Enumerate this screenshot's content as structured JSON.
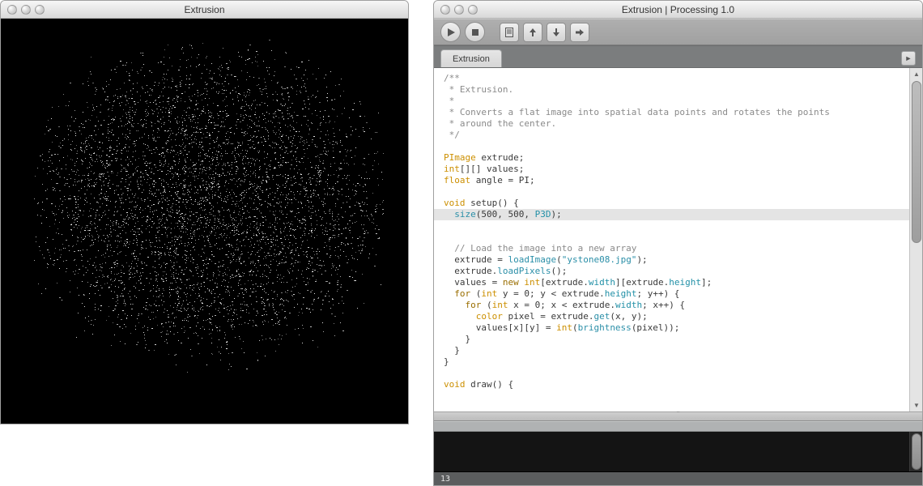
{
  "sketch_window": {
    "title": "Extrusion"
  },
  "ide_window": {
    "title": "Extrusion | Processing 1.0",
    "toolbar": {
      "run": "Run",
      "stop": "Stop",
      "new": "New",
      "open": "Open",
      "save": "Save",
      "export": "Export"
    },
    "tab": {
      "label": "Extrusion",
      "add_tooltip": "New tab"
    }
  },
  "code": {
    "comment_block": [
      "/**",
      " * Extrusion.",
      " *",
      " * Converts a flat image into spatial data points and rotates the points",
      " * around the center.",
      " */"
    ],
    "decl": {
      "PImage": "PImage",
      "extrude_var": "extrude;",
      "int": "int",
      "values_decl": "[][] values;",
      "float": "float",
      "angle_decl": "angle = PI;"
    },
    "setup": {
      "void": "void",
      "setup_sig": "setup() {",
      "size_fn": "size",
      "size_args_pre": "(500, 500, ",
      "p3d": "P3D",
      "size_args_post": ");",
      "comment_load": "// Load the image into a new array",
      "assign_prefix": "extrude = ",
      "loadImage": "loadImage",
      "img_str": "\"ystone08.jpg\"",
      "assign_suffix": ");",
      "loadPixels_line": "extrude.",
      "loadPixels": "loadPixels",
      "loadPixels_suffix": "();",
      "values_assign_pre": "values = ",
      "new_kw": "new",
      "values_assign_type": "int",
      "values_dims": "[extrude.",
      "width_kw": "width",
      "values_dims_mid": "][extrude.",
      "height_kw": "height",
      "values_dims_suf": "];",
      "for": "for",
      "outer_for_pre": " (",
      "int_kw": "int",
      "outer_for": " y = 0; y < extrude.",
      "outer_for_suf": "; y++) {",
      "inner_for": " x = 0; x < extrude.",
      "inner_for_suf": "; x++) {",
      "color_kw": "color",
      "pixel_line_mid": " pixel = extrude.",
      "get_kw": "get",
      "pixel_line_suf": "(x, y);",
      "values_set_pre": "values[x][y] = ",
      "int_cast": "int",
      "brightness": "brightness",
      "values_set_suf": "(pixel));",
      "brace_close": "}"
    },
    "draw": {
      "void": "void",
      "draw_sig": "draw() {"
    }
  },
  "status": {
    "line_number": "13"
  },
  "drag_glyph": "ˆ",
  "arrows": {
    "up": "▲",
    "down": "▼",
    "right": "►",
    "add": "►"
  }
}
